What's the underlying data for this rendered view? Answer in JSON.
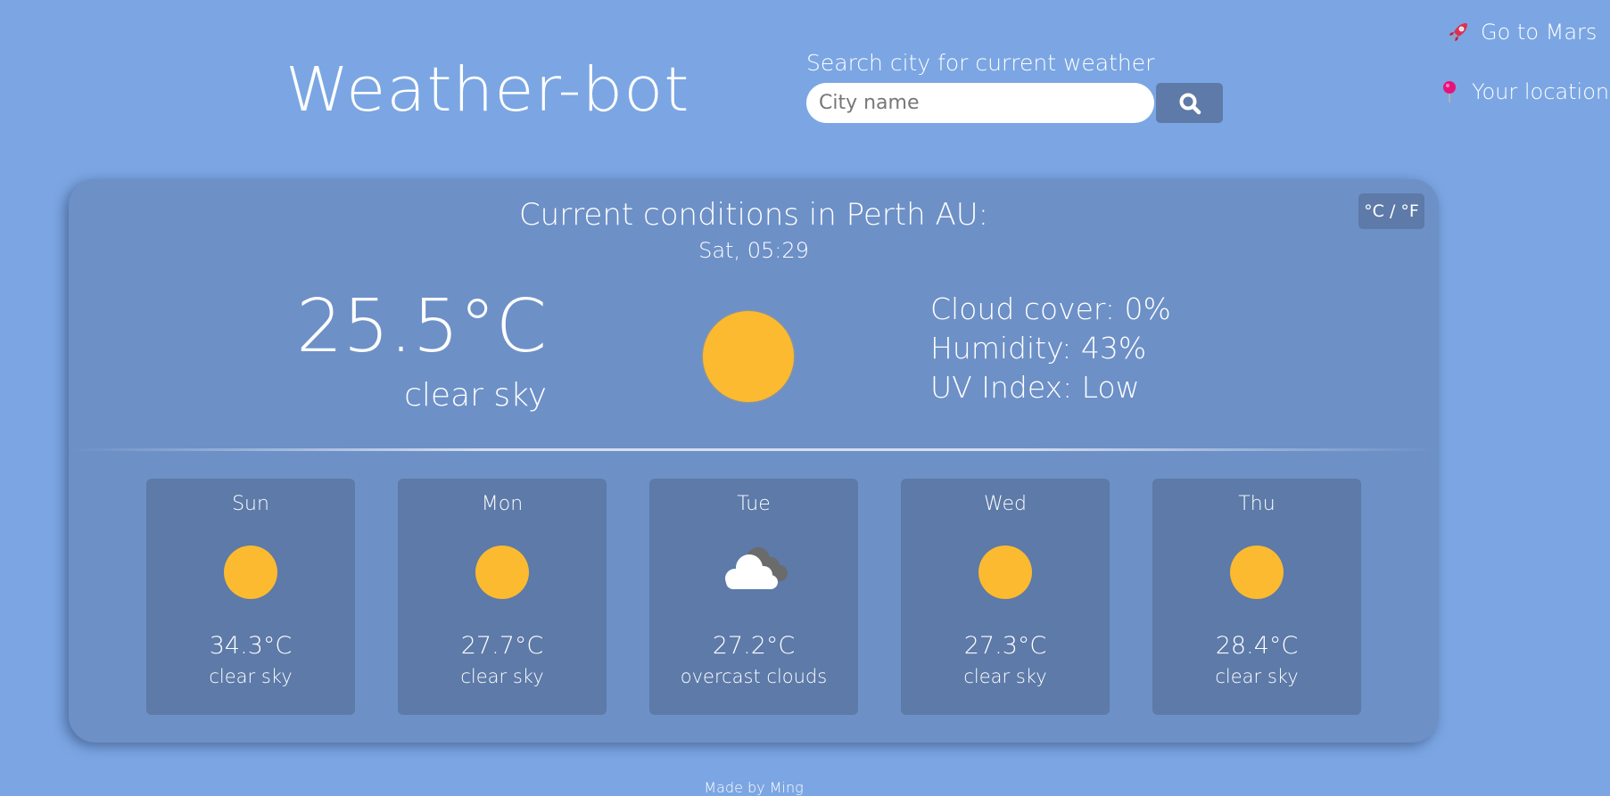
{
  "header": {
    "app_title": "Weather-bot",
    "search": {
      "label": "Search city for current weather",
      "placeholder": "City name",
      "value": "",
      "button_icon": "search-icon"
    },
    "links": [
      {
        "label": "Go to Mars",
        "icon": "rocket-icon"
      },
      {
        "label": "Your location",
        "icon": "pushpin-icon"
      }
    ]
  },
  "current": {
    "unit_toggle": "°C / °F",
    "title": "Current conditions in Perth AU:",
    "datetime": "Sat, 05:29",
    "temperature": "25.5°C",
    "description": "clear sky",
    "icon": "sun-icon",
    "stats": [
      "Cloud cover: 0%",
      "Humidity: 43%",
      "UV Index: Low"
    ]
  },
  "forecast": [
    {
      "day": "Sun",
      "temp": "34.3°C",
      "desc": "clear sky",
      "icon": "sun-icon"
    },
    {
      "day": "Mon",
      "temp": "27.7°C",
      "desc": "clear sky",
      "icon": "sun-icon"
    },
    {
      "day": "Tue",
      "temp": "27.2°C",
      "desc": "overcast clouds",
      "icon": "cloud-icon"
    },
    {
      "day": "Wed",
      "temp": "27.3°C",
      "desc": "clear sky",
      "icon": "sun-icon"
    },
    {
      "day": "Thu",
      "temp": "28.4°C",
      "desc": "clear sky",
      "icon": "sun-icon"
    }
  ],
  "colors": {
    "background": "#7ba6e3",
    "card": "#6d90c7",
    "panel": "#5d7aa8",
    "sun": "#fbba30"
  },
  "footer": "Made by Ming"
}
